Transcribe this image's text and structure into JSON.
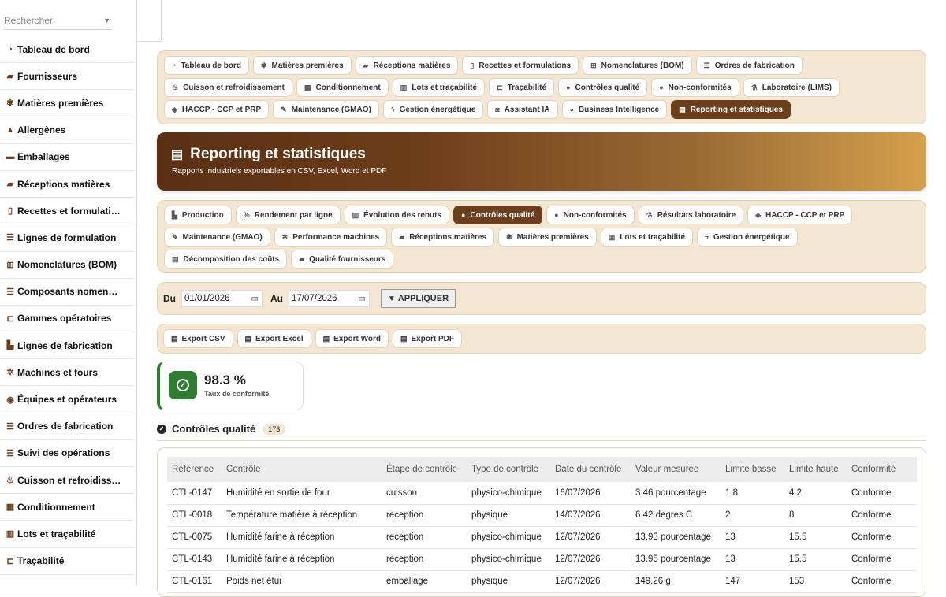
{
  "sidebar": {
    "search_placeholder": "Rechercher",
    "items": [
      {
        "label": "Tableau de bord",
        "icon": "gauge-icon",
        "glyph": "◔"
      },
      {
        "label": "Fournisseurs",
        "icon": "truck-icon",
        "glyph": "▰"
      },
      {
        "label": "Matières premières",
        "icon": "seedling-icon",
        "glyph": "✾"
      },
      {
        "label": "Allergènes",
        "icon": "warning-icon",
        "glyph": "▲"
      },
      {
        "label": "Emballages",
        "icon": "box-icon",
        "glyph": "▬"
      },
      {
        "label": "Réceptions matières",
        "icon": "truck-loading-icon",
        "glyph": "▰"
      },
      {
        "label": "Recettes et formulati…",
        "icon": "book-icon",
        "glyph": "▯"
      },
      {
        "label": "Lignes de formulation",
        "icon": "list-icon",
        "glyph": "☰"
      },
      {
        "label": "Nomenclatures (BOM)",
        "icon": "sitemap-icon",
        "glyph": "⊞"
      },
      {
        "label": "Composants nomen…",
        "icon": "list-icon",
        "glyph": "☰"
      },
      {
        "label": "Gammes opératoires",
        "icon": "route-icon",
        "glyph": "⊏"
      },
      {
        "label": "Lignes de fabrication",
        "icon": "industry-icon",
        "glyph": "▙"
      },
      {
        "label": "Machines et fours",
        "icon": "cogs-icon",
        "glyph": "✲"
      },
      {
        "label": "Équipes et opérateurs",
        "icon": "users-icon",
        "glyph": "◉"
      },
      {
        "label": "Ordres de fabrication",
        "icon": "list-icon",
        "glyph": "☰"
      },
      {
        "label": "Suivi des opérations",
        "icon": "list-icon",
        "glyph": "☰"
      },
      {
        "label": "Cuisson et refroidiss…",
        "icon": "fire-icon",
        "glyph": "♨"
      },
      {
        "label": "Conditionnement",
        "icon": "boxes-icon",
        "glyph": "▦"
      },
      {
        "label": "Lots et traçabilité",
        "icon": "barcode-icon",
        "glyph": "▥"
      },
      {
        "label": "Traçabilité",
        "icon": "route-icon",
        "glyph": "⊏"
      }
    ]
  },
  "main_tabs": [
    {
      "label": "Tableau de bord",
      "icon": "gauge-icon",
      "glyph": "◔",
      "active": false
    },
    {
      "label": "Matières premières",
      "icon": "seedling-icon",
      "glyph": "✾",
      "active": false
    },
    {
      "label": "Réceptions matières",
      "icon": "truck-loading-icon",
      "glyph": "▰",
      "active": false
    },
    {
      "label": "Recettes et formulations",
      "icon": "book-icon",
      "glyph": "▯",
      "active": false
    },
    {
      "label": "Nomenclatures (BOM)",
      "icon": "sitemap-icon",
      "glyph": "⊞",
      "active": false
    },
    {
      "label": "Ordres de fabrication",
      "icon": "list-icon",
      "glyph": "☰",
      "active": false
    },
    {
      "label": "Cuisson et refroidissement",
      "icon": "fire-icon",
      "glyph": "♨",
      "active": false
    },
    {
      "label": "Conditionnement",
      "icon": "boxes-icon",
      "glyph": "▦",
      "active": false
    },
    {
      "label": "Lots et traçabilité",
      "icon": "barcode-icon",
      "glyph": "▥",
      "active": false
    },
    {
      "label": "Traçabilité",
      "icon": "route-icon",
      "glyph": "⊏",
      "active": false
    },
    {
      "label": "Contrôles qualité",
      "icon": "check-circle-icon",
      "glyph": "●",
      "active": false
    },
    {
      "label": "Non-conformités",
      "icon": "exclamation-circle-icon",
      "glyph": "●",
      "active": false
    },
    {
      "label": "Laboratoire (LIMS)",
      "icon": "flask-icon",
      "glyph": "⚗",
      "active": false
    },
    {
      "label": "HACCP - CCP et PRP",
      "icon": "shield-icon",
      "glyph": "◈",
      "active": false
    },
    {
      "label": "Maintenance (GMAO)",
      "icon": "wrench-icon",
      "glyph": "✎",
      "active": false
    },
    {
      "label": "Gestion énergétique",
      "icon": "bolt-icon",
      "glyph": "ϟ",
      "active": false
    },
    {
      "label": "Assistant IA",
      "icon": "robot-icon",
      "glyph": "◙",
      "active": false
    },
    {
      "label": "Business Intelligence",
      "icon": "chart-pie-icon",
      "glyph": "◕",
      "active": false
    },
    {
      "label": "Reporting et statistiques",
      "icon": "file-icon",
      "glyph": "▤",
      "active": true
    }
  ],
  "hero": {
    "title": "Reporting et statistiques",
    "subtitle": "Rapports industriels exportables en CSV, Excel, Word et PDF"
  },
  "report_tabs": [
    {
      "label": "Production",
      "icon": "industry-icon",
      "glyph": "▙",
      "active": false
    },
    {
      "label": "Rendement par ligne",
      "icon": "percent-icon",
      "glyph": "%",
      "active": false
    },
    {
      "label": "Évolution des rebuts",
      "icon": "trash-icon",
      "glyph": "▥",
      "active": false
    },
    {
      "label": "Contrôles qualité",
      "icon": "check-circle-icon",
      "glyph": "●",
      "active": true
    },
    {
      "label": "Non-conformités",
      "icon": "exclamation-circle-icon",
      "glyph": "●",
      "active": false
    },
    {
      "label": "Résultats laboratoire",
      "icon": "flask-icon",
      "glyph": "⚗",
      "active": false
    },
    {
      "label": "HACCP - CCP et PRP",
      "icon": "shield-icon",
      "glyph": "◈",
      "active": false
    },
    {
      "label": "Maintenance (GMAO)",
      "icon": "wrench-icon",
      "glyph": "✎",
      "active": false
    },
    {
      "label": "Performance machines",
      "icon": "cogs-icon",
      "glyph": "✲",
      "active": false
    },
    {
      "label": "Réceptions matières",
      "icon": "truck-loading-icon",
      "glyph": "▰",
      "active": false
    },
    {
      "label": "Matières premières",
      "icon": "seedling-icon",
      "glyph": "✾",
      "active": false
    },
    {
      "label": "Lots et traçabilité",
      "icon": "barcode-icon",
      "glyph": "▥",
      "active": false
    },
    {
      "label": "Gestion énergétique",
      "icon": "bolt-icon",
      "glyph": "ϟ",
      "active": false
    },
    {
      "label": "Décomposition des coûts",
      "icon": "coins-icon",
      "glyph": "▤",
      "active": false
    },
    {
      "label": "Qualité fournisseurs",
      "icon": "truck-icon",
      "glyph": "▰",
      "active": false
    }
  ],
  "filters": {
    "from_label": "Du",
    "from_value": "01/01/2026",
    "to_label": "Au",
    "to_value": "17/07/2026",
    "apply_label": "APPLIQUER"
  },
  "exports": [
    {
      "label": "Export CSV",
      "icon": "file-csv-icon"
    },
    {
      "label": "Export Excel",
      "icon": "file-excel-icon"
    },
    {
      "label": "Export Word",
      "icon": "file-word-icon"
    },
    {
      "label": "Export PDF",
      "icon": "file-pdf-icon"
    }
  ],
  "kpi": {
    "value": "98.3 %",
    "label": "Taux de conformité"
  },
  "section": {
    "title": "Contrôles qualité",
    "count": "173"
  },
  "table": {
    "columns": [
      "Référence",
      "Contrôle",
      "Étape de contrôle",
      "Type de contrôle",
      "Date du contrôle",
      "Valeur mesurée",
      "Limite basse",
      "Limite haute",
      "Conformité"
    ],
    "rows": [
      [
        "CTL-0147",
        "Humidité en sortie de four",
        "cuisson",
        "physico-chimique",
        "16/07/2026",
        "3.46 pourcentage",
        "1.8",
        "4.2",
        "Conforme"
      ],
      [
        "CTL-0018",
        "Température matière à réception",
        "reception",
        "physique",
        "14/07/2026",
        "6.42 degres C",
        "2",
        "8",
        "Conforme"
      ],
      [
        "CTL-0075",
        "Humidité farine à réception",
        "reception",
        "physico-chimique",
        "12/07/2026",
        "13.93 pourcentage",
        "13",
        "15.5",
        "Conforme"
      ],
      [
        "CTL-0143",
        "Humidité farine à réception",
        "reception",
        "physico-chimique",
        "12/07/2026",
        "13.95 pourcentage",
        "13",
        "15.5",
        "Conforme"
      ],
      [
        "CTL-0161",
        "Poids net étui",
        "emballage",
        "physique",
        "12/07/2026",
        "149.26 g",
        "147",
        "153",
        "Conforme"
      ]
    ]
  }
}
